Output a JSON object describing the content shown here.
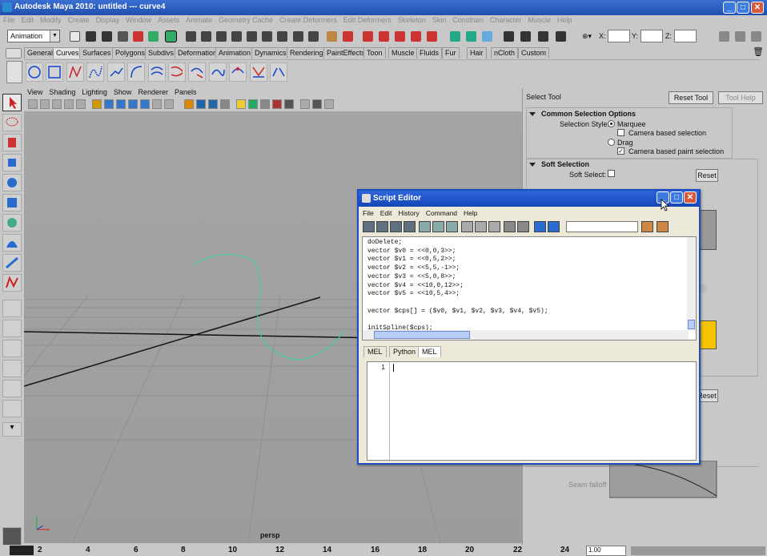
{
  "window": {
    "title": "Autodesk Maya 2010: untitled   ---   curve4",
    "min": "_",
    "max": "□",
    "close": "✕"
  },
  "menubar": [
    "File",
    "Edit",
    "Modify",
    "Create",
    "Display",
    "Window",
    "Assets",
    "Animate",
    "Geometry Cache",
    "Create Deformers",
    "Edit Deformers",
    "Skeleton",
    "Skin",
    "Constrain",
    "Character",
    "Muscle",
    "Help"
  ],
  "statusline": {
    "menuset": "Animation",
    "x_label": "X:",
    "y_label": "Y:",
    "z_label": "Z:"
  },
  "shelf_tabs": [
    "General",
    "Curves",
    "Surfaces",
    "Polygons",
    "Subdivs",
    "Deformation",
    "Animation",
    "Dynamics",
    "Rendering",
    "PaintEffects",
    "Toon",
    "Muscle",
    "Fluids",
    "Fur",
    "Hair",
    "nCloth",
    "Custom"
  ],
  "shelf_active": "Curves",
  "panel_menu": [
    "View",
    "Shading",
    "Lighting",
    "Show",
    "Renderer",
    "Panels"
  ],
  "viewport": {
    "camera": "persp"
  },
  "timeline": {
    "ticks": [
      "2",
      "4",
      "6",
      "8",
      "10",
      "12",
      "14",
      "16",
      "18",
      "20",
      "22",
      "24"
    ],
    "current": "1.00"
  },
  "tool_settings": {
    "title": "Select Tool",
    "reset": "Reset Tool",
    "help": "Tool Help",
    "common": {
      "heading": "Common Selection Options",
      "style_label": "Selection Style:",
      "marquee": "Marquee",
      "camera_based": "Camera based selection",
      "drag": "Drag",
      "camera_paint": "Camera based paint selection"
    },
    "soft": {
      "heading": "Soft Selection",
      "soft_select_label": "Soft Select:",
      "reset": "Reset",
      "reset2": "Reset",
      "seam_falloff": "Seam falloff"
    }
  },
  "script_editor": {
    "title": "Script Editor",
    "menu": [
      "File",
      "Edit",
      "History",
      "Command",
      "Help"
    ],
    "history": "doDelete;\nvector $v0 = <<0,0,3>>;\nvector $v1 = <<0,5,2>>;\nvector $v2 = <<5,5,-1>>;\nvector $v3 = <<5,0,8>>;\nvector $v4 = <<10,0,12>>;\nvector $v5 = <<10,5,4>>;\n\nvector $cps[] = ($v0, $v1, $v2, $v3, $v4, $v5);\n\ninitSpline($cps);",
    "tabs": [
      "MEL",
      "Python",
      "MEL"
    ],
    "active_tab": "MEL",
    "line_number": "1"
  }
}
